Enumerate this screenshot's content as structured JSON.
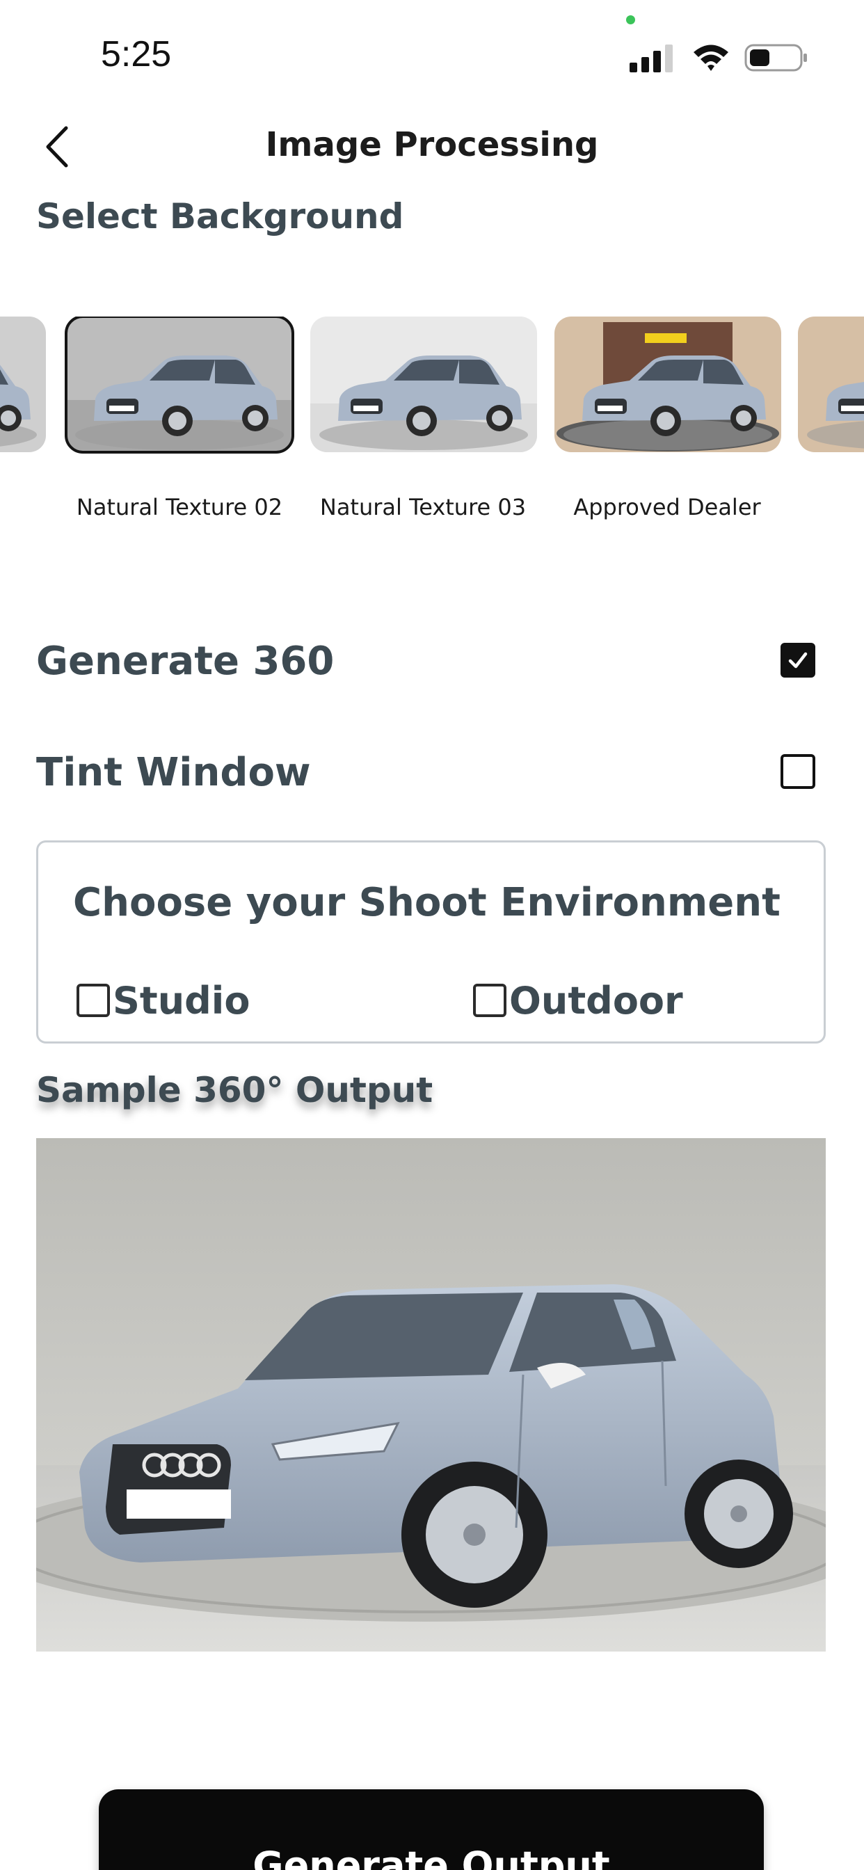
{
  "status_bar": {
    "time": "5:25"
  },
  "header": {
    "title": "Image Processing",
    "back_icon": "chevron-left-icon"
  },
  "background_section": {
    "heading": "Select Background",
    "items": [
      {
        "label": "Natural Texture 02",
        "selected": true
      },
      {
        "label": "Natural Texture 03",
        "selected": false
      },
      {
        "label": "Approved Dealer",
        "selected": false
      }
    ]
  },
  "options": {
    "generate_360": {
      "label": "Generate 360",
      "checked": true
    },
    "tint_window": {
      "label": "Tint Window",
      "checked": false
    }
  },
  "environment": {
    "title": "Choose your Shoot Environment",
    "studio_label": "Studio",
    "outdoor_label": "Outdoor"
  },
  "sample_section": {
    "heading": "Sample 360° Output"
  },
  "actions": {
    "generate_label": "Generate Output"
  },
  "colors": {
    "text_primary": "#3d4a52",
    "button_bg": "#0a0a0a",
    "car_body": "#a9b6c8"
  }
}
